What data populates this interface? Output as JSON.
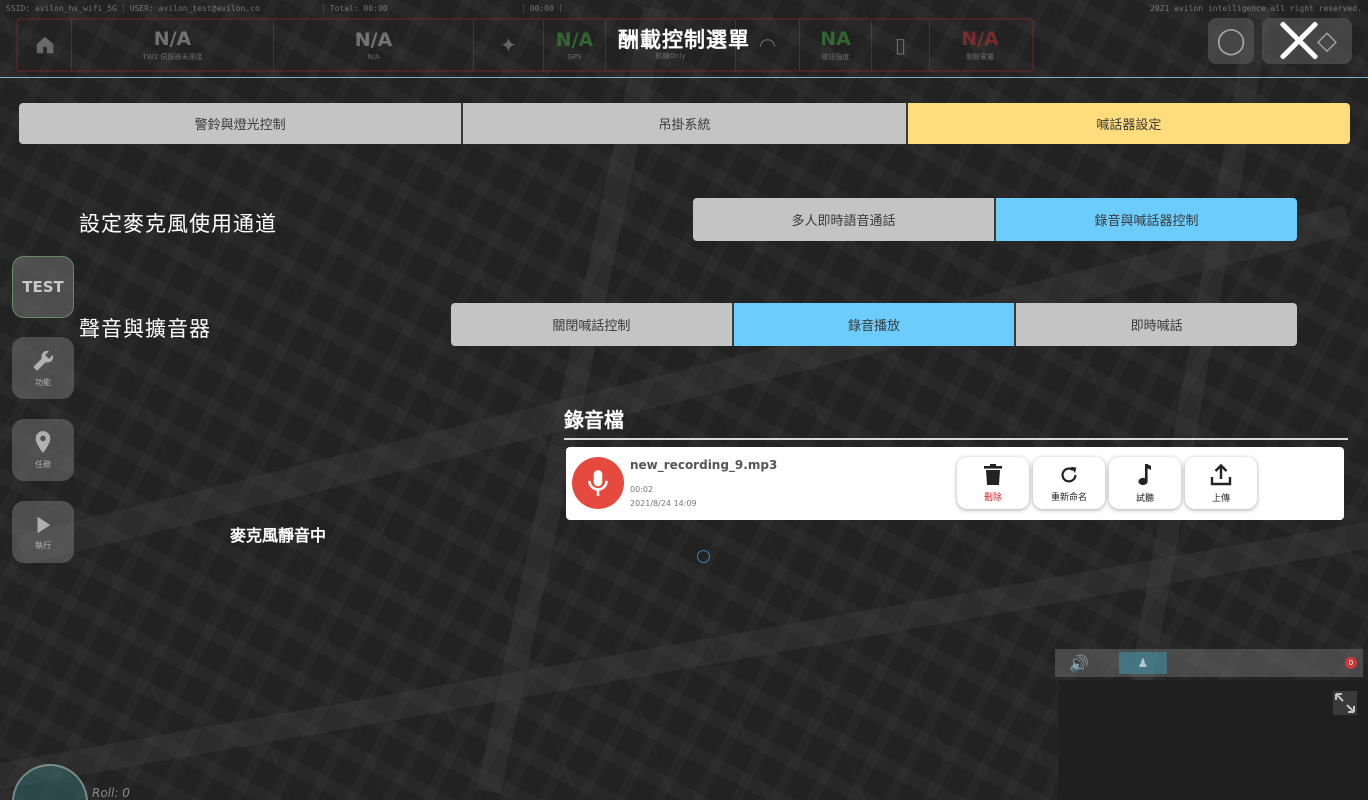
{
  "hud": {
    "ssid": "SSID: avilon_hs_wifi_5G",
    "user": "USER: avilon_test@avilon.co",
    "total": "Total: 00:00",
    "timer": "00:00",
    "copyright": "2021 avilon intelligence all right reserved.",
    "cells": [
      {
        "value": "N/A",
        "caption": "TW2 伺服器未連接"
      },
      {
        "value": "N/A",
        "caption": "N/A"
      },
      {
        "value": "N/A",
        "caption": "GPS"
      },
      {
        "value": "N/A",
        "caption": "航線Only"
      },
      {
        "value": "NA",
        "caption": "收訊強度"
      },
      {
        "value": "N/A",
        "caption": "剩餘電量"
      }
    ]
  },
  "header": {
    "title": "酬載控制選單"
  },
  "tabs": [
    {
      "label": "警鈴與燈光控制"
    },
    {
      "label": "吊掛系統"
    },
    {
      "label": "喊話器設定"
    }
  ],
  "mic_channel": {
    "label": "設定麥克風使用通道",
    "options": [
      {
        "label": "多人即時語音通話"
      },
      {
        "label": "錄音與喊話器控制"
      }
    ]
  },
  "sound": {
    "label": "聲音與擴音器",
    "options": [
      {
        "label": "關閉喊話控制"
      },
      {
        "label": "錄音播放"
      },
      {
        "label": "即時喊話"
      }
    ]
  },
  "sidebar": {
    "test_label": "TEST",
    "function_label": "功能",
    "mission_label": "任務",
    "execute_label": "執行"
  },
  "recordings": {
    "title": "錄音檔",
    "items": [
      {
        "name": "new_recording_9.mp3",
        "duration": "00:02",
        "date": "2021/8/24 14:09"
      }
    ],
    "actions": {
      "delete": "刪除",
      "rename": "重新命名",
      "preview": "試聽",
      "upload": "上傳"
    }
  },
  "mic_status": "麥克風靜音中",
  "telemetry": {
    "roll": "Roll: 0"
  },
  "video": {
    "badge": "0"
  },
  "colors": {
    "tab_active": "#ffdc7c",
    "option_active": "#6ccdfd",
    "option_inactive": "#c4c4c4",
    "mic_avatar": "#e64a3f",
    "delete_label": "#d32020"
  },
  "icons": {
    "home": "home-icon",
    "satellite": "satellite-icon",
    "wifi": "wifi-icon",
    "battery": "battery-icon",
    "bulb": "lightbulb-icon",
    "layers": "layers-icon",
    "close": "close-icon",
    "wrench": "wrench-icon",
    "pin": "location-pin-icon",
    "play": "play-icon",
    "mic": "microphone-icon",
    "trash": "trash-icon",
    "refresh": "refresh-icon",
    "music": "music-note-icon",
    "upload": "upload-icon",
    "volume": "volume-icon",
    "expand": "expand-icon"
  }
}
